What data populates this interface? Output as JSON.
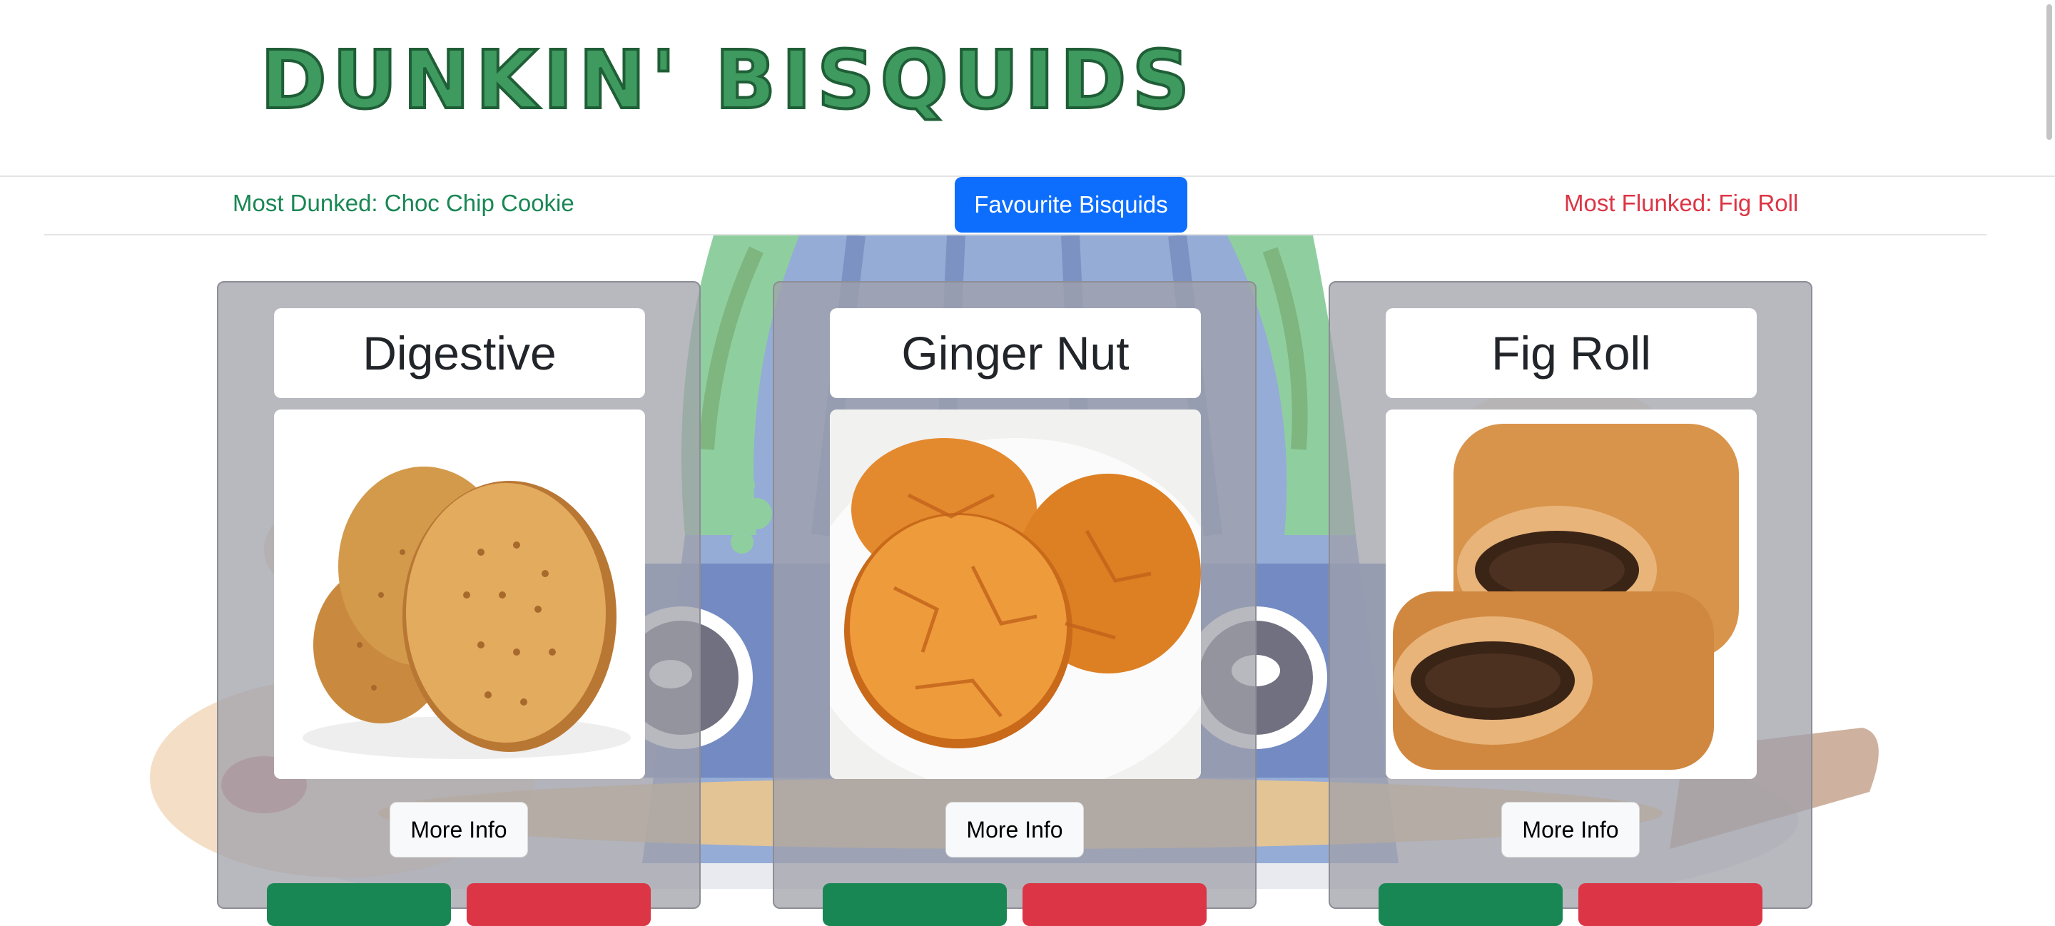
{
  "site": {
    "title": "DUNKIN' BISQUIDS"
  },
  "stats": {
    "most_dunked": "Most Dunked: Choc Chip Cookie",
    "most_flunked": "Most Flunked: Fig Roll"
  },
  "nav": {
    "favourite_button": "Favourite Bisquids"
  },
  "cards": [
    {
      "name": "Digestive",
      "more_info": "More Info",
      "image_icon": "digestive-biscuit-image"
    },
    {
      "name": "Ginger Nut",
      "more_info": "More Info",
      "image_icon": "ginger-nut-biscuit-image"
    },
    {
      "name": "Fig Roll",
      "more_info": "More Info",
      "image_icon": "fig-roll-biscuit-image"
    }
  ],
  "colors": {
    "logo_fill": "#3e9a5f",
    "logo_outline": "#1f5e36",
    "dunked_text": "#198754",
    "flunked_text": "#dc3545",
    "primary_button": "#0d6efd",
    "dunk_button": "#198754",
    "flunk_button": "#dc3545",
    "card_background": "#a0a0aa"
  }
}
